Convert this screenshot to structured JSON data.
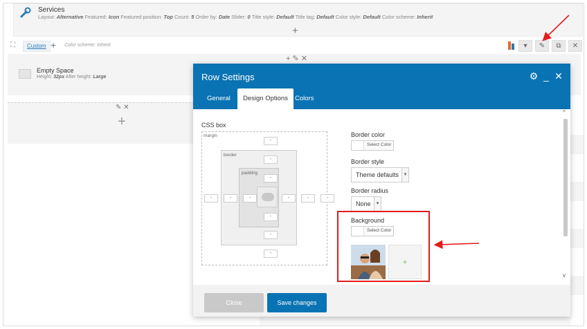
{
  "services": {
    "title": "Services",
    "meta_prefix": "Layout:",
    "meta": [
      {
        "key": "Layout:",
        "value": "Alternative"
      },
      {
        "key": "Featured:",
        "value": "Icon"
      },
      {
        "key": "Featured position:",
        "value": "Top"
      },
      {
        "key": "Count:",
        "value": "5"
      },
      {
        "key": "Order by:",
        "value": "Date"
      },
      {
        "key": "Slider:",
        "value": "0"
      },
      {
        "key": "Title style:",
        "value": "Default"
      },
      {
        "key": "Title tag:",
        "value": "Default"
      },
      {
        "key": "Color style:",
        "value": "Default"
      },
      {
        "key": "Color scheme:",
        "value": "Inherit"
      }
    ]
  },
  "row_toolbar": {
    "custom_tab": "Custom",
    "scheme_label": "Color scheme: Inherit"
  },
  "empty_space": {
    "title": "Empty Space",
    "meta": [
      {
        "key": "Height:",
        "value": "32px"
      },
      {
        "key": "After height:",
        "value": "Large"
      }
    ]
  },
  "modal": {
    "title": "Row Settings",
    "tabs": [
      {
        "label": "General"
      },
      {
        "label": "Design Options"
      },
      {
        "label": "Colors"
      }
    ],
    "css_box_label": "CSS box",
    "box_labels": {
      "margin": "margin",
      "border": "border",
      "padding": "padding"
    },
    "box_value": "-",
    "border_color_label": "Border color",
    "select_color": "Select Color",
    "border_style_label": "Border style",
    "border_style_value": "Theme defaults",
    "border_radius_label": "Border radius",
    "border_radius_value": "None",
    "background_label": "Background",
    "add_symbol": "+",
    "close_button": "Close",
    "save_button": "Save changes"
  },
  "colors": {
    "header_blue": "#0a73b3",
    "annotation_red": "#e21b1b"
  }
}
